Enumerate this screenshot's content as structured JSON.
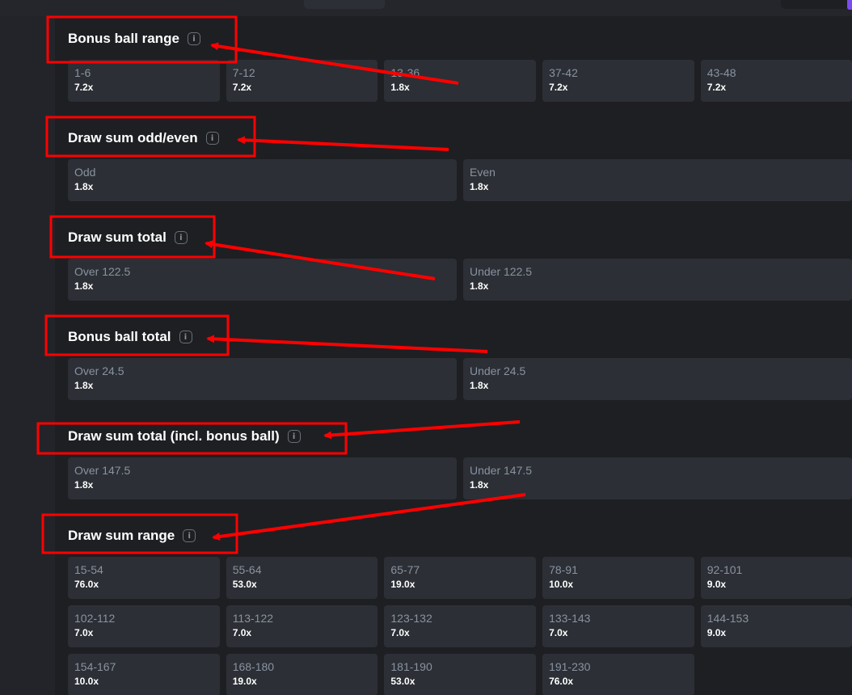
{
  "sections": [
    {
      "title": "Bonus ball range",
      "info_icon": "info-icon",
      "columns": 5,
      "options": [
        {
          "label": "1-6",
          "odds": "7.2x"
        },
        {
          "label": "7-12",
          "odds": "7.2x"
        },
        {
          "label": "13-36",
          "odds": "1.8x"
        },
        {
          "label": "37-42",
          "odds": "7.2x"
        },
        {
          "label": "43-48",
          "odds": "7.2x"
        }
      ]
    },
    {
      "title": "Draw sum odd/even",
      "info_icon": "info-icon",
      "columns": 2,
      "options": [
        {
          "label": "Odd",
          "odds": "1.8x"
        },
        {
          "label": "Even",
          "odds": "1.8x"
        }
      ]
    },
    {
      "title": "Draw sum total",
      "info_icon": "info-icon",
      "columns": 2,
      "options": [
        {
          "label": "Over 122.5",
          "odds": "1.8x"
        },
        {
          "label": "Under 122.5",
          "odds": "1.8x"
        }
      ]
    },
    {
      "title": "Bonus ball total",
      "info_icon": "info-icon",
      "columns": 2,
      "options": [
        {
          "label": "Over 24.5",
          "odds": "1.8x"
        },
        {
          "label": "Under 24.5",
          "odds": "1.8x"
        }
      ]
    },
    {
      "title": "Draw sum total (incl. bonus ball)",
      "info_icon": "info-icon",
      "columns": 2,
      "options": [
        {
          "label": "Over 147.5",
          "odds": "1.8x"
        },
        {
          "label": "Under 147.5",
          "odds": "1.8x"
        }
      ]
    },
    {
      "title": "Draw sum range",
      "info_icon": "info-icon",
      "columns": 5,
      "options": [
        {
          "label": "15-54",
          "odds": "76.0x"
        },
        {
          "label": "55-64",
          "odds": "53.0x"
        },
        {
          "label": "65-77",
          "odds": "19.0x"
        },
        {
          "label": "78-91",
          "odds": "10.0x"
        },
        {
          "label": "92-101",
          "odds": "9.0x"
        },
        {
          "label": "102-112",
          "odds": "7.0x"
        },
        {
          "label": "113-122",
          "odds": "7.0x"
        },
        {
          "label": "123-132",
          "odds": "7.0x"
        },
        {
          "label": "133-143",
          "odds": "7.0x"
        },
        {
          "label": "144-153",
          "odds": "9.0x"
        },
        {
          "label": "154-167",
          "odds": "10.0x"
        },
        {
          "label": "168-180",
          "odds": "19.0x"
        },
        {
          "label": "181-190",
          "odds": "53.0x"
        },
        {
          "label": "191-230",
          "odds": "76.0x"
        }
      ]
    }
  ],
  "colors": {
    "background": "#1e1f23",
    "tile": "#2c2f35",
    "label": "#8993a0",
    "value": "#ffffff",
    "annotation": "#ff0000",
    "accent": "#7b4cf0"
  }
}
